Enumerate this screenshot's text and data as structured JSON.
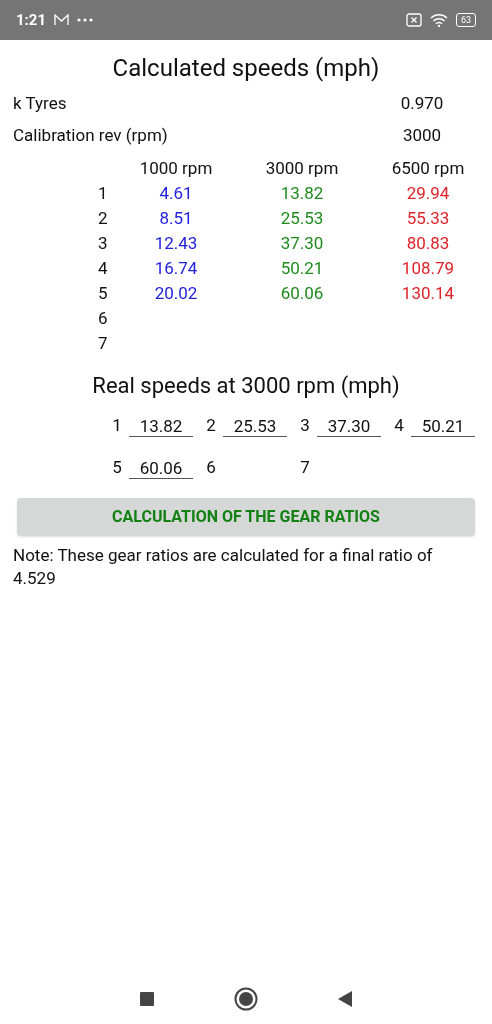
{
  "status_bar": {
    "time": "1:21",
    "battery": "63"
  },
  "title": "Calculated speeds (mph)",
  "settings": [
    {
      "label": "k Tyres",
      "value": "0.970"
    },
    {
      "label": "Calibration rev (rpm)",
      "value": "3000"
    }
  ],
  "table": {
    "columns": [
      {
        "label": "1000 rpm",
        "color": "#2222dd"
      },
      {
        "label": "3000 rpm",
        "color": "#1e8a1e"
      },
      {
        "label": "6500 rpm",
        "color": "#e0222a"
      }
    ],
    "rows": [
      {
        "gear": "1",
        "values": [
          "4.61",
          "13.82",
          "29.94"
        ]
      },
      {
        "gear": "2",
        "values": [
          "8.51",
          "25.53",
          "55.33"
        ]
      },
      {
        "gear": "3",
        "values": [
          "12.43",
          "37.30",
          "80.83"
        ]
      },
      {
        "gear": "4",
        "values": [
          "16.74",
          "50.21",
          "108.79"
        ]
      },
      {
        "gear": "5",
        "values": [
          "20.02",
          "60.06",
          "130.14"
        ]
      },
      {
        "gear": "6",
        "values": []
      },
      {
        "gear": "7",
        "values": []
      }
    ]
  },
  "real_title": "Real speeds at 3000 rpm (mph)",
  "real_speeds": [
    {
      "gear": "1",
      "value": "13.82"
    },
    {
      "gear": "2",
      "value": "25.53"
    },
    {
      "gear": "3",
      "value": "37.30"
    },
    {
      "gear": "4",
      "value": "50.21"
    },
    {
      "gear": "5",
      "value": "60.06"
    },
    {
      "gear": "6"
    },
    {
      "gear": "7"
    }
  ],
  "button": "CALCULATION OF THE GEAR RATIOS",
  "note": "Note: These gear ratios are calculated for a final ratio of 4.529"
}
